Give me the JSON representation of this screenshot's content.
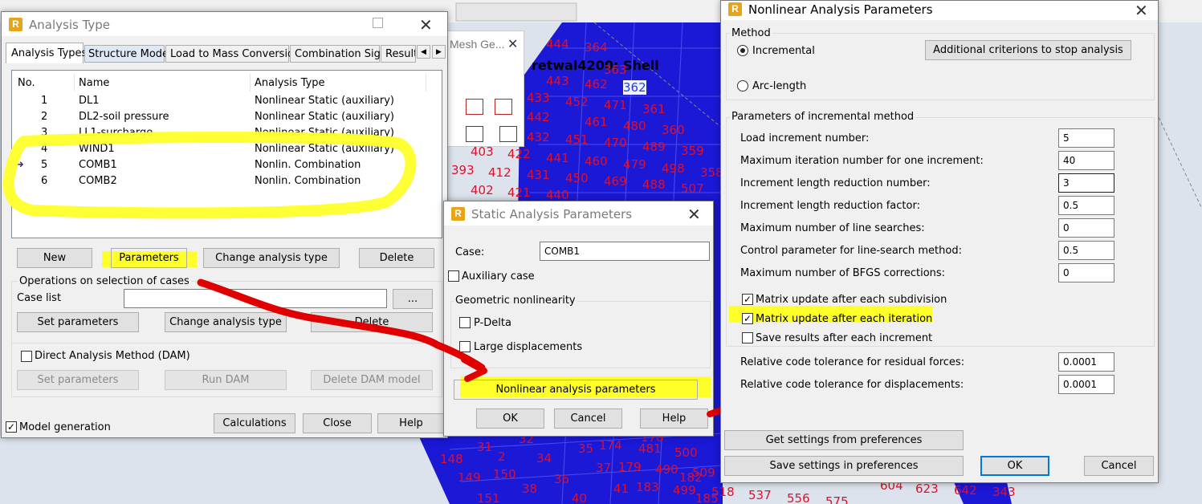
{
  "background": {
    "view_title": "retwal4200: Shell",
    "mesh_panel_title": "Mesh Ge...",
    "node_numbers": [
      {
        "t": "444"
      },
      {
        "t": "364"
      },
      {
        "t": "363"
      },
      {
        "t": "443"
      },
      {
        "t": "462"
      },
      {
        "t": "362",
        "sel": true
      },
      {
        "t": "433"
      },
      {
        "t": "452"
      },
      {
        "t": "471"
      },
      {
        "t": "361"
      },
      {
        "t": "442"
      },
      {
        "t": "461"
      },
      {
        "t": "480"
      },
      {
        "t": "360"
      },
      {
        "t": "432"
      },
      {
        "t": "451"
      },
      {
        "t": "470"
      },
      {
        "t": "489"
      },
      {
        "t": "359"
      },
      {
        "t": "403"
      },
      {
        "t": "422"
      },
      {
        "t": "441"
      },
      {
        "t": "460"
      },
      {
        "t": "479"
      },
      {
        "t": "498"
      },
      {
        "t": "358"
      },
      {
        "t": "393"
      },
      {
        "t": "412"
      },
      {
        "t": "431"
      },
      {
        "t": "450"
      },
      {
        "t": "469"
      },
      {
        "t": "488"
      },
      {
        "t": "507"
      },
      {
        "t": "402"
      },
      {
        "t": "421"
      },
      {
        "t": "440"
      },
      {
        "t": "31"
      },
      {
        "t": "32"
      },
      {
        "t": "35"
      },
      {
        "t": "174"
      },
      {
        "t": "481"
      },
      {
        "t": "500"
      },
      {
        "t": "178"
      },
      {
        "t": "148"
      },
      {
        "t": "2"
      },
      {
        "t": "34"
      },
      {
        "t": "37"
      },
      {
        "t": "179"
      },
      {
        "t": "490"
      },
      {
        "t": "182"
      },
      {
        "t": "509"
      },
      {
        "t": "149"
      },
      {
        "t": "150"
      },
      {
        "t": "36"
      },
      {
        "t": "183"
      },
      {
        "t": "499"
      },
      {
        "t": "185"
      },
      {
        "t": "518"
      },
      {
        "t": "537"
      },
      {
        "t": "556"
      },
      {
        "t": "575"
      },
      {
        "t": "604"
      },
      {
        "t": "623"
      },
      {
        "t": "642"
      },
      {
        "t": "343"
      },
      {
        "t": "38"
      },
      {
        "t": "40"
      },
      {
        "t": "41"
      },
      {
        "t": "151"
      }
    ]
  },
  "analysis_type": {
    "title": "Analysis Type",
    "tabs": [
      "Analysis Types",
      "Structure Model",
      "Load to Mass Conversion",
      "Combination Sign",
      "Result"
    ],
    "columns": [
      "No.",
      "Name",
      "Analysis Type"
    ],
    "rows": [
      {
        "no": "1",
        "name": "DL1",
        "type": "Nonlinear Static (auxiliary)"
      },
      {
        "no": "2",
        "name": "DL2-soil pressure",
        "type": "Nonlinear Static (auxiliary)"
      },
      {
        "no": "3",
        "name": "LL1-surcharge",
        "type": "Nonlinear Static (auxiliary)"
      },
      {
        "no": "4",
        "name": "WIND1",
        "type": "Nonlinear Static (auxiliary)"
      },
      {
        "no": "5",
        "name": "COMB1",
        "type": "Nonlin. Combination"
      },
      {
        "no": "6",
        "name": "COMB2",
        "type": "Nonlin. Combination"
      }
    ],
    "buttons": {
      "new": "New",
      "parameters": "Parameters",
      "change": "Change analysis type",
      "delete": "Delete"
    },
    "operations_label": "Operations on selection of cases",
    "case_list_label": "Case list",
    "case_list_value": "",
    "browse": "...",
    "op_buttons": {
      "set": "Set parameters",
      "change": "Change analysis type",
      "delete": "Delete"
    },
    "dam_label": "Direct Analysis Method (DAM)",
    "dam_buttons": {
      "set": "Set parameters",
      "run": "Run DAM",
      "delete": "Delete DAM model"
    },
    "model_generation": "Model generation",
    "bottom_buttons": {
      "calc": "Calculations",
      "close": "Close",
      "help": "Help"
    }
  },
  "static_params": {
    "title": "Static Analysis Parameters",
    "case_label": "Case:",
    "case_value": "COMB1",
    "auxiliary": "Auxiliary case",
    "geom_label": "Geometric nonlinearity",
    "pdelta": "P-Delta",
    "large": "Large displacements",
    "nonlinear_btn": "Nonlinear analysis parameters",
    "ok": "OK",
    "cancel": "Cancel",
    "help": "Help"
  },
  "nonlinear_params": {
    "title": "Nonlinear Analysis Parameters",
    "method_label": "Method",
    "incremental": "Incremental",
    "arc_length": "Arc-length",
    "criteria_btn": "Additional criterions to stop analysis",
    "params_label": "Parameters of incremental method",
    "fields": [
      {
        "label": "Load increment number:",
        "value": "5"
      },
      {
        "label": "Maximum iteration number for one increment:",
        "value": "40"
      },
      {
        "label": "Increment length reduction number:",
        "value": "3"
      },
      {
        "label": "Increment length reduction factor:",
        "value": "0.5"
      },
      {
        "label": "Maximum number of line searches:",
        "value": "0"
      },
      {
        "label": "Control parameter for line-search method:",
        "value": "0.5"
      },
      {
        "label": "Maximum number of BFGS corrections:",
        "value": "0"
      }
    ],
    "checks": [
      {
        "label": "Matrix update after each subdivision",
        "checked": true
      },
      {
        "label": "Matrix update after each iteration",
        "checked": true
      },
      {
        "label": "Save results after each increment",
        "checked": false
      }
    ],
    "tol_fields": [
      {
        "label": "Relative code tolerance for residual forces:",
        "value": "0.0001"
      },
      {
        "label": "Relative code tolerance for displacements:",
        "value": "0.0001"
      }
    ],
    "get_prefs": "Get settings from preferences",
    "save_prefs": "Save settings in preferences",
    "ok": "OK",
    "cancel": "Cancel"
  },
  "colors": {
    "highlight": "#ffff2a",
    "annotation": "#e00000",
    "mesh": "#1a1ad8",
    "focus": "#0078d7"
  }
}
